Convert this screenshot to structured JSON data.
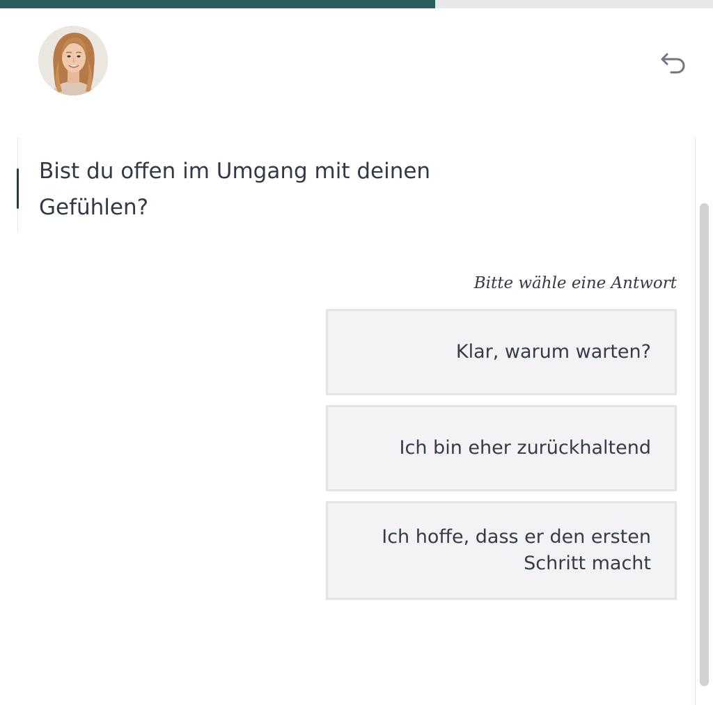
{
  "progress": {
    "value": 0.61,
    "fill_color": "#285f5b",
    "track_color": "#e7e9e8"
  },
  "header": {
    "avatar_icon": "portrait-avatar",
    "back_icon": "undo-arrow-icon"
  },
  "question": {
    "text": "Bist du offen im Umgang mit deinen Gefühlen?"
  },
  "answers": {
    "hint": "Bitte wähle eine Antwort",
    "options": [
      {
        "label": "Klar, warum warten?"
      },
      {
        "label": "Ich bin eher zurückhaltend"
      },
      {
        "label": "Ich hoffe, dass er den ersten Schritt macht"
      }
    ]
  }
}
